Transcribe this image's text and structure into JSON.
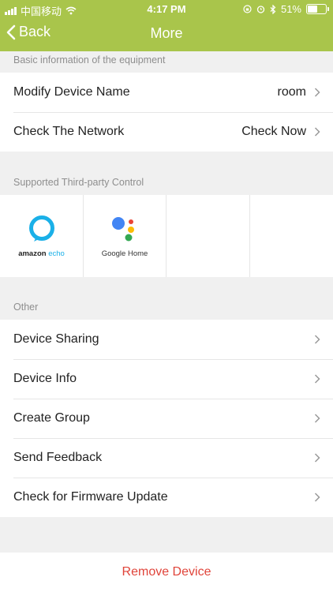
{
  "status_bar": {
    "carrier": "中国移动",
    "time": "4:17 PM",
    "battery_text": "51%",
    "battery_level": 0.51
  },
  "nav": {
    "back_label": "Back",
    "title": "More"
  },
  "basic_info": {
    "header": "Basic information of the equipment",
    "rows": [
      {
        "label": "Modify Device Name",
        "value": "room"
      },
      {
        "label": "Check The Network",
        "value": "Check Now"
      }
    ]
  },
  "third_party": {
    "header": "Supported Third-party Control",
    "items": [
      {
        "name": "amazon echo",
        "brand": "amazon",
        "product": "echo",
        "icon": "alexa-ring-icon"
      },
      {
        "name": "Google Home",
        "icon": "google-assistant-dots-icon"
      }
    ]
  },
  "other": {
    "header": "Other",
    "rows": [
      {
        "label": "Device Sharing"
      },
      {
        "label": "Device Info"
      },
      {
        "label": "Create Group"
      },
      {
        "label": "Send Feedback"
      },
      {
        "label": "Check for Firmware Update"
      }
    ]
  },
  "remove_label": "Remove Device",
  "colors": {
    "accent": "#a9c54b",
    "danger": "#e0443a",
    "background": "#f0f0f0",
    "alexa_blue": "#1ab0e8",
    "google_blue": "#4285f4",
    "google_red": "#ea4335",
    "google_yellow": "#fbbc05",
    "google_green": "#34a853"
  }
}
